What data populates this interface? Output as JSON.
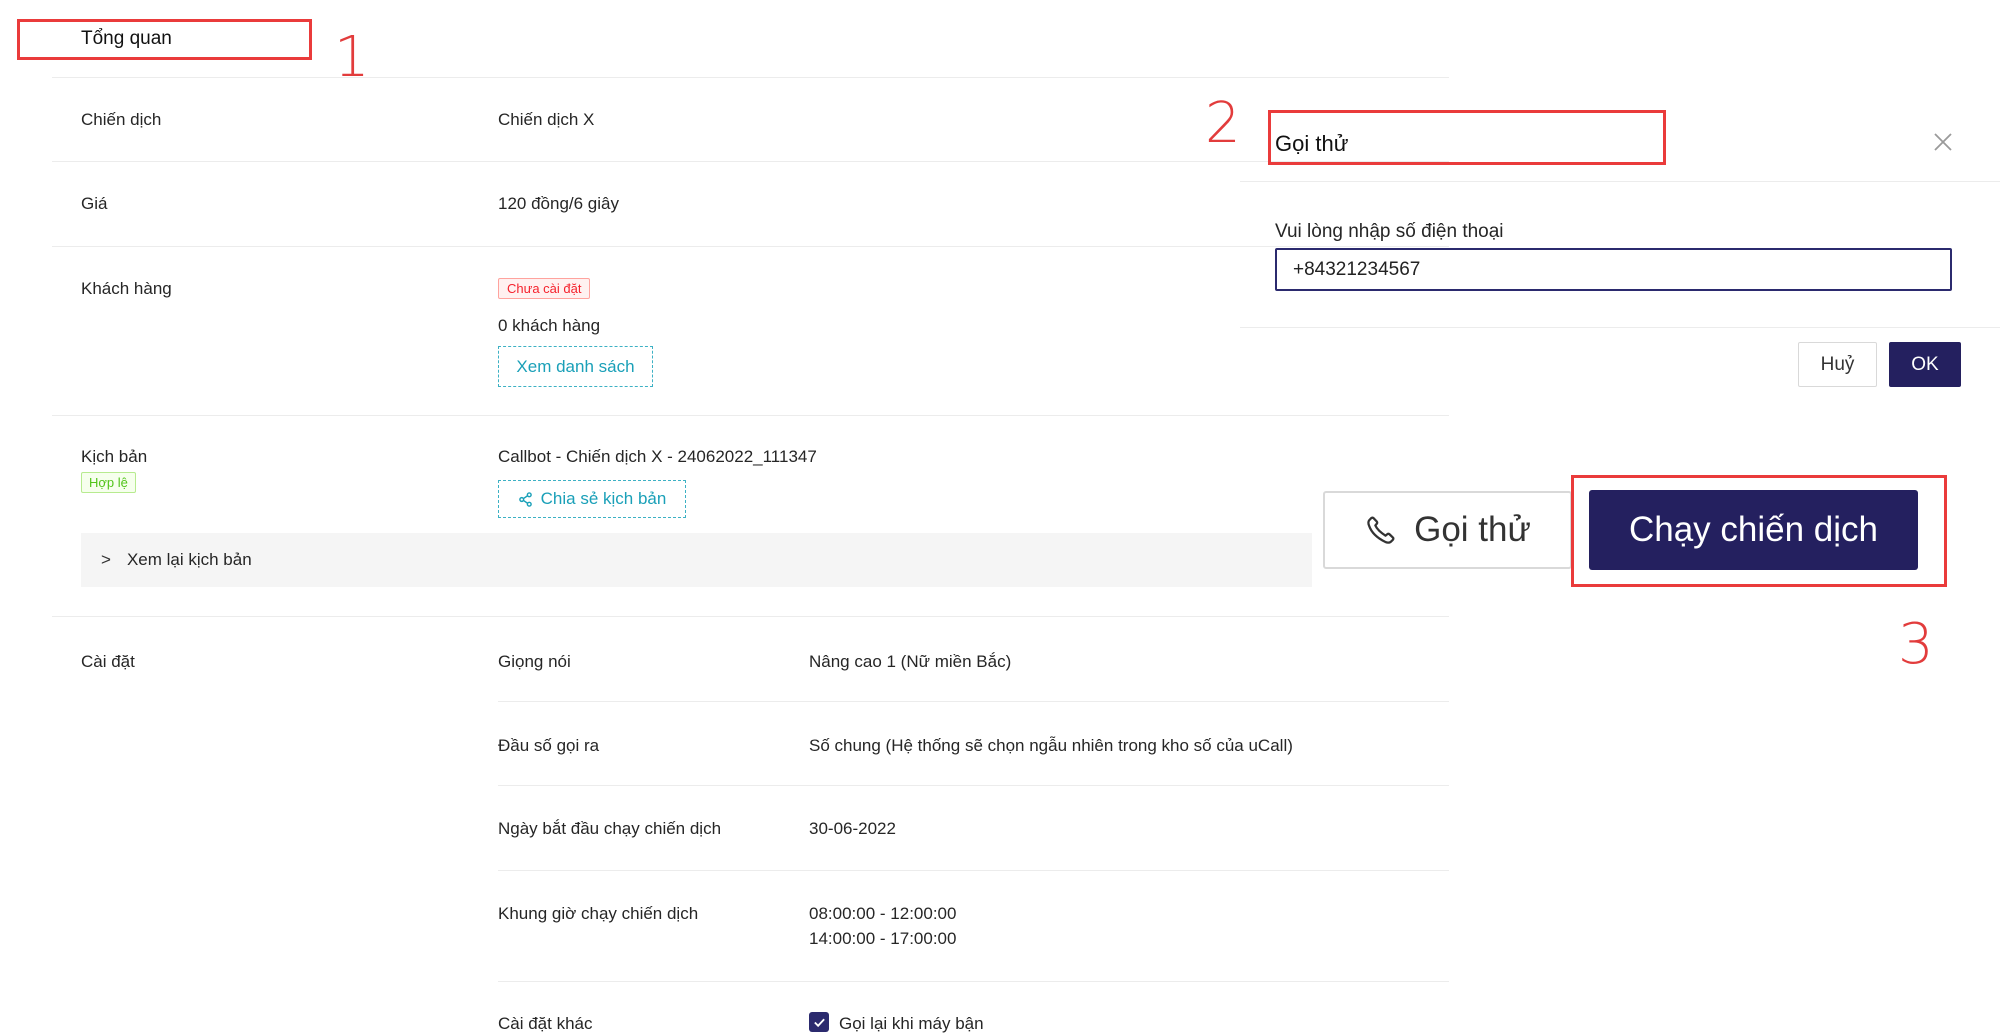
{
  "overview": {
    "title": "Tổng quan",
    "rows": {
      "campaign": {
        "label": "Chiến dịch",
        "value": "Chiến dịch X"
      },
      "price": {
        "label": "Giá",
        "value": "120 đồng/6 giây"
      },
      "customers": {
        "label": "Khách hàng",
        "status_tag": "Chưa cài đặt",
        "count": "0 khách hàng",
        "view_list_button": "Xem danh sách"
      },
      "script": {
        "label": "Kịch bản",
        "status_tag": "Hợp lệ",
        "value": "Callbot - Chiến dịch X - 24062022_111347",
        "share_button": "Chia sẻ kịch bản",
        "review_toggle": "Xem lại kịch bản"
      },
      "settings": {
        "label": "Cài đặt",
        "items": [
          {
            "label": "Giọng nói",
            "value": "Nâng cao 1 (Nữ miền Bắc)"
          },
          {
            "label": "Đầu số gọi ra",
            "value": "Số chung (Hệ thống sẽ chọn ngẫu nhiên trong kho số của uCall)"
          },
          {
            "label": "Ngày bắt đầu chạy chiến dịch",
            "value": "30-06-2022"
          },
          {
            "label": "Khung giờ chạy chiến dịch",
            "value_lines": [
              "08:00:00 - 12:00:00",
              "14:00:00 - 17:00:00"
            ]
          },
          {
            "label": "Cài đặt khác",
            "checkbox_label": "Gọi lại khi máy bận",
            "checked": true
          }
        ]
      }
    }
  },
  "test_call_modal": {
    "title": "Gọi thử",
    "phone_label": "Vui lòng nhập số điện thoại",
    "phone_value": "+84321234567",
    "cancel_button": "Huỷ",
    "ok_button": "OK"
  },
  "actions": {
    "test_call_button": "Gọi thử",
    "run_campaign_button": "Chạy chiến dịch"
  },
  "annotations": {
    "step1": "1",
    "step2": "2",
    "step3": "3",
    "color": "#e23c3c"
  },
  "colors": {
    "primary": "#24205f",
    "accent_teal": "#1aa0b8",
    "tag_red": "#f5222d",
    "tag_green": "#52c41a"
  }
}
